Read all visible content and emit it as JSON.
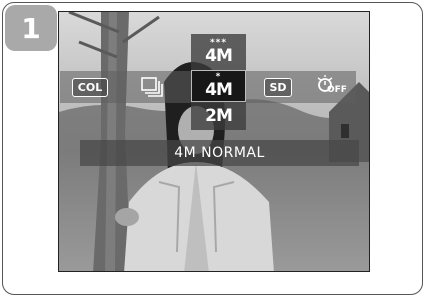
{
  "step_number": "1",
  "menu": {
    "items": [
      {
        "label": "COL",
        "icon": "color-mode-icon"
      },
      {
        "label": "",
        "icon": "drive-mode-icon"
      },
      {
        "label": "4M",
        "icon": "resolution-icon"
      },
      {
        "label": "SD",
        "icon": "sd-card-icon"
      },
      {
        "label": "OFF",
        "icon": "self-timer-off-icon"
      }
    ]
  },
  "resolution_options": [
    {
      "stars": "***",
      "label": "4M"
    },
    {
      "stars": "*",
      "label": "4M",
      "selected": true
    },
    {
      "stars": "",
      "label": "2M"
    }
  ],
  "status": {
    "text": "4M NORMAL"
  },
  "colors": {
    "badge": "#a9a9a9",
    "menu_bar": "#5f5f5f",
    "selected": "#171717"
  }
}
